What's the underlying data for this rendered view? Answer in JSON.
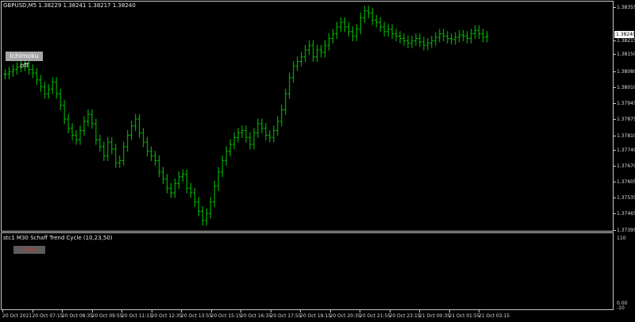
{
  "main_chart": {
    "symbol_info": "GBPUSD,M5  1.38229 1.38241 1.38217 1.38240",
    "ichimoku_button": "Ichimoku off",
    "current_price": "1.38240",
    "up_color": "#00c800"
  },
  "indicator": {
    "title": "stc1 M30 Schaff Trend Cycle (10,23,50)",
    "badge": "0.00",
    "axis_top": "110",
    "axis_bottom_1": "0.00",
    "axis_bottom_2": "-10"
  },
  "price_axis": [
    "1.38355",
    "1.38215",
    "1.38150",
    "1.38080",
    "1.38010",
    "1.37945",
    "1.37875",
    "1.37810",
    "1.37740",
    "1.37670",
    "1.37605",
    "1.37535",
    "1.37465",
    "1.37395"
  ],
  "time_axis": [
    "20 Oct 2021",
    "20 Oct 07:15",
    "20 Oct 08:35",
    "20 Oct 09:55",
    "20 Oct 11:15",
    "20 Oct 12:35",
    "20 Oct 13:55",
    "20 Oct 15:15",
    "20 Oct 16:35",
    "20 Oct 17:55",
    "20 Oct 19:15",
    "20 Oct 20:35",
    "20 Oct 21:55",
    "20 Oct 23:15",
    "21 Oct 00:35",
    "21 Oct 01:55",
    "21 Oct 03:15"
  ],
  "chart_data": {
    "type": "bar",
    "title": "",
    "ylim": [
      1.37395,
      1.3839
    ],
    "closes": [
      1.38075,
      1.38085,
      1.38095,
      1.38105,
      1.38118,
      1.3811,
      1.38095,
      1.3808,
      1.3805,
      1.3802,
      1.3799,
      1.3801,
      1.3804,
      1.3799,
      1.3794,
      1.3788,
      1.3784,
      1.3781,
      1.3779,
      1.3783,
      1.3787,
      1.379,
      1.3786,
      1.3779,
      1.3776,
      1.3772,
      1.3778,
      1.3775,
      1.3769,
      1.377,
      1.3776,
      1.3781,
      1.3785,
      1.3788,
      1.3782,
      1.3778,
      1.3774,
      1.3772,
      1.377,
      1.3765,
      1.3762,
      1.3758,
      1.3756,
      1.376,
      1.3763,
      1.3764,
      1.3758,
      1.3756,
      1.3752,
      1.3748,
      1.3744,
      1.3747,
      1.3752,
      1.3759,
      1.3765,
      1.377,
      1.3774,
      1.3777,
      1.378,
      1.3782,
      1.3783,
      1.378,
      1.3777,
      1.3782,
      1.3786,
      1.3784,
      1.3781,
      1.378,
      1.3783,
      1.3787,
      1.3792,
      1.3799,
      1.3806,
      1.3811,
      1.3813,
      1.3815,
      1.3818,
      1.382,
      1.3815,
      1.3818,
      1.3817,
      1.382,
      1.3823,
      1.3825,
      1.3828,
      1.383,
      1.3828,
      1.3826,
      1.3824,
      1.3827,
      1.3832,
      1.3835,
      1.3834,
      1.3831,
      1.383,
      1.3828,
      1.3826,
      1.3827,
      1.3825,
      1.3824,
      1.3823,
      1.3822,
      1.3821,
      1.3822,
      1.3823,
      1.38215,
      1.382,
      1.3821,
      1.3822,
      1.38235,
      1.3825,
      1.3824,
      1.3823,
      1.38225,
      1.38235,
      1.38245,
      1.3824,
      1.3823,
      1.3825,
      1.38265,
      1.3825,
      1.38235,
      1.3824
    ]
  }
}
